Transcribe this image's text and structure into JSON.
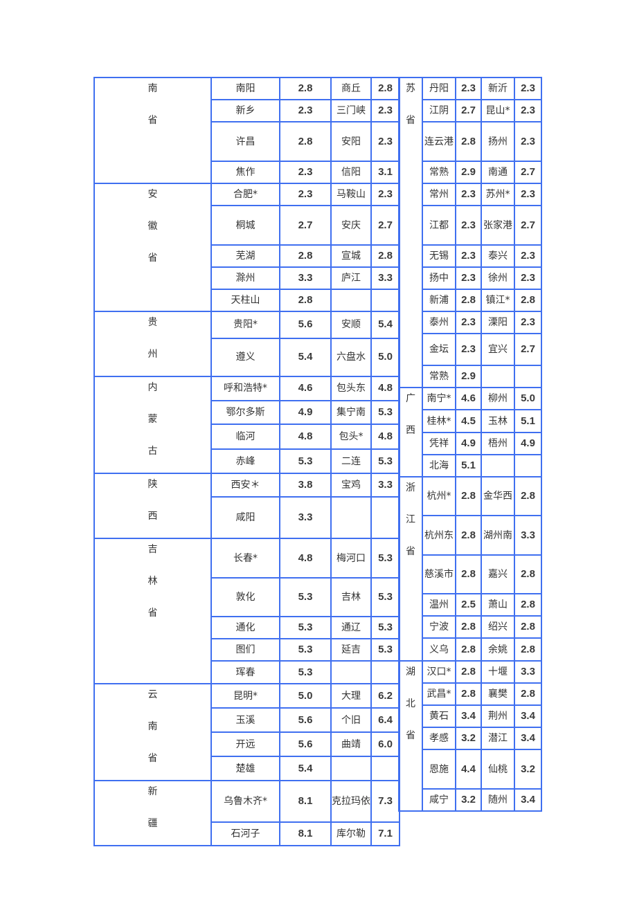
{
  "left_table": {
    "groups": [
      {
        "province_chars": [
          "南",
          "省"
        ],
        "rows": [
          {
            "city1": "南阳",
            "value1": "2.8",
            "city2": "商丘",
            "value2": "2.8",
            "h": 32
          },
          {
            "city1": "新乡",
            "value1": "2.3",
            "city2": "三门峡",
            "value2": "2.3",
            "h": 32
          },
          {
            "city1": "许昌",
            "value1": "2.8",
            "city2": "安阳",
            "value2": "2.3",
            "h": 57
          },
          {
            "city1": "焦作",
            "value1": "2.3",
            "city2": "信阳",
            "value2": "3.1",
            "h": 32
          }
        ]
      },
      {
        "province_chars": [
          "安",
          "徽",
          "省"
        ],
        "rows": [
          {
            "city1": "合肥*",
            "value1": "2.3",
            "city2": "马鞍山",
            "value2": "2.3",
            "h": 32
          },
          {
            "city1": "桐城",
            "value1": "2.7",
            "city2": "安庆",
            "value2": "2.7",
            "h": 57
          },
          {
            "city1": "芜湖",
            "value1": "2.8",
            "city2": "宣城",
            "value2": "2.8",
            "h": 32
          },
          {
            "city1": "滁州",
            "value1": "3.3",
            "city2": "庐江",
            "value2": "3.3",
            "h": 32
          },
          {
            "city1": "天柱山",
            "value1": "2.8",
            "city2": "",
            "value2": "",
            "h": 32
          }
        ]
      },
      {
        "province_chars": [
          "贵",
          "州"
        ],
        "rows": [
          {
            "city1": "贵阳*",
            "value1": "5.6",
            "city2": "安顺",
            "value2": "5.4",
            "h": 32
          },
          {
            "city1": "遵义",
            "value1": "5.4",
            "city2": "六盘水",
            "value2": "5.0",
            "h": 46
          }
        ]
      },
      {
        "province_chars": [
          "内",
          "蒙",
          "古"
        ],
        "rows": [
          {
            "city1": "呼和浩特*",
            "value1": "4.6",
            "city2": "包头东",
            "value2": "4.8",
            "h": 32
          },
          {
            "city1": "鄂尔多斯",
            "value1": "4.9",
            "city2": "集宁南",
            "value2": "5.3",
            "h": 32
          },
          {
            "city1": "临河",
            "value1": "4.8",
            "city2": "包头*",
            "value2": "4.8",
            "h": 33
          },
          {
            "city1": "赤峰",
            "value1": "5.3",
            "city2": "二连",
            "value2": "5.3",
            "h": 32
          }
        ]
      },
      {
        "province_chars": [
          "陕",
          "西"
        ],
        "rows": [
          {
            "city1": "西安＊",
            "value1": "3.8",
            "city2": "宝鸡",
            "value2": "3.3",
            "h": 32
          },
          {
            "city1": "咸阳",
            "value1": "3.3",
            "city2": "",
            "value2": "",
            "h": 56
          }
        ]
      },
      {
        "province_chars": [
          "吉",
          "林",
          "省"
        ],
        "rows": [
          {
            "city1": "长春*",
            "value1": "4.8",
            "city2": "梅河口",
            "value2": "5.3",
            "h": 57
          },
          {
            "city1": "敦化",
            "value1": "5.3",
            "city2": "吉林",
            "value2": "5.3",
            "h": 56
          },
          {
            "city1": "通化",
            "value1": "5.3",
            "city2": "通辽",
            "value2": "5.3",
            "h": 32
          },
          {
            "city1": "图们",
            "value1": "5.3",
            "city2": "延吉",
            "value2": "5.3",
            "h": 32
          },
          {
            "city1": "珲春",
            "value1": "5.3",
            "city2": "",
            "value2": "",
            "h": 33
          }
        ]
      },
      {
        "province_chars": [
          "云",
          "南",
          "省"
        ],
        "rows": [
          {
            "city1": "昆明*",
            "value1": "5.0",
            "city2": "大理",
            "value2": "6.2",
            "h": 32
          },
          {
            "city1": "玉溪",
            "value1": "5.6",
            "city2": "个旧",
            "value2": "6.4",
            "h": 32
          },
          {
            "city1": "开远",
            "value1": "5.6",
            "city2": "曲靖",
            "value2": "6.0",
            "h": 32
          },
          {
            "city1": "楚雄",
            "value1": "5.4",
            "city2": "",
            "value2": "",
            "h": 32
          }
        ]
      },
      {
        "province_chars": [
          "新",
          "疆"
        ],
        "rows": [
          {
            "city1": "乌鲁木齐*",
            "value1": "8.1",
            "city2": "克拉玛依",
            "value2": "7.3",
            "h": 57
          },
          {
            "city1": "石河子",
            "value1": "8.1",
            "city2": "库尔勒",
            "value2": "7.1",
            "h": 32
          }
        ]
      }
    ]
  },
  "right_table": {
    "groups": [
      {
        "province_chars": [
          "苏",
          "省"
        ],
        "rows": [
          {
            "city1": "丹阳",
            "value1": "2.3",
            "city2": "新沂",
            "value2": "2.3",
            "h": 32
          },
          {
            "city1": "江阴",
            "value1": "2.7",
            "city2": "昆山*",
            "value2": "2.3",
            "h": 32
          },
          {
            "city1": "连云港",
            "value1": "2.8",
            "city2": "扬州",
            "value2": "2.3",
            "h": 57
          },
          {
            "city1": "常熟",
            "value1": "2.9",
            "city2": "南通",
            "value2": "2.7",
            "h": 32
          },
          {
            "city1": "常州",
            "value1": "2.3",
            "city2": "苏州*",
            "value2": "2.3",
            "h": 32
          },
          {
            "city1": "江都",
            "value1": "2.3",
            "city2": "张家港",
            "value2": "2.7",
            "h": 57
          },
          {
            "city1": "无锡",
            "value1": "2.3",
            "city2": "泰兴",
            "value2": "2.3",
            "h": 32
          },
          {
            "city1": "扬中",
            "value1": "2.3",
            "city2": "徐州",
            "value2": "2.3",
            "h": 32
          },
          {
            "city1": "新浦",
            "value1": "2.8",
            "city2": "镇江*",
            "value2": "2.8",
            "h": 32
          },
          {
            "city1": "泰州",
            "value1": "2.3",
            "city2": "溧阳",
            "value2": "2.3",
            "h": 32
          },
          {
            "city1": "金坛",
            "value1": "2.3",
            "city2": "宜兴",
            "value2": "2.7",
            "h": 46
          },
          {
            "city1": "常熟",
            "value1": "2.9",
            "city2": "",
            "value2": "",
            "h": 32
          }
        ]
      },
      {
        "province_chars": [
          "广",
          "西"
        ],
        "rows": [
          {
            "city1": "南宁*",
            "value1": "4.6",
            "city2": "柳州",
            "value2": "5.0",
            "h": 32
          },
          {
            "city1": "桂林*",
            "value1": "4.5",
            "city2": "玉林",
            "value2": "5.1",
            "h": 33
          },
          {
            "city1": "凭祥",
            "value1": "4.9",
            "city2": "梧州",
            "value2": "4.9",
            "h": 32
          },
          {
            "city1": "北海",
            "value1": "5.1",
            "city2": "",
            "value2": "",
            "h": 32
          }
        ]
      },
      {
        "province_chars": [
          "浙",
          "江",
          "省"
        ],
        "rows": [
          {
            "city1": "杭州*",
            "value1": "2.8",
            "city2": "金华西",
            "value2": "2.8",
            "h": 56
          },
          {
            "city1": "杭州东",
            "value1": "2.8",
            "city2": "湖州南",
            "value2": "3.3",
            "h": 57
          },
          {
            "city1": "慈溪市",
            "value1": "2.8",
            "city2": "嘉兴",
            "value2": "2.8",
            "h": 56
          },
          {
            "city1": "温州",
            "value1": "2.5",
            "city2": "萧山",
            "value2": "2.8",
            "h": 32
          },
          {
            "city1": "宁波",
            "value1": "2.8",
            "city2": "绍兴",
            "value2": "2.8",
            "h": 32
          },
          {
            "city1": "义乌",
            "value1": "2.8",
            "city2": "余姚",
            "value2": "2.8",
            "h": 33
          }
        ]
      },
      {
        "province_chars": [
          "湖",
          "北",
          "省"
        ],
        "rows": [
          {
            "city1": "汉口*",
            "value1": "2.8",
            "city2": "十堰",
            "value2": "3.3",
            "h": 32
          },
          {
            "city1": "武昌*",
            "value1": "2.8",
            "city2": "襄樊",
            "value2": "2.8",
            "h": 32
          },
          {
            "city1": "黄石",
            "value1": "3.4",
            "city2": "荆州",
            "value2": "3.4",
            "h": 32
          },
          {
            "city1": "孝感",
            "value1": "3.2",
            "city2": "潜江",
            "value2": "3.4",
            "h": 32
          },
          {
            "city1": "恩施",
            "value1": "4.4",
            "city2": "仙桃",
            "value2": "3.2",
            "h": 57
          },
          {
            "city1": "咸宁",
            "value1": "3.2",
            "city2": "随州",
            "value2": "3.4",
            "h": 32
          }
        ]
      }
    ]
  }
}
